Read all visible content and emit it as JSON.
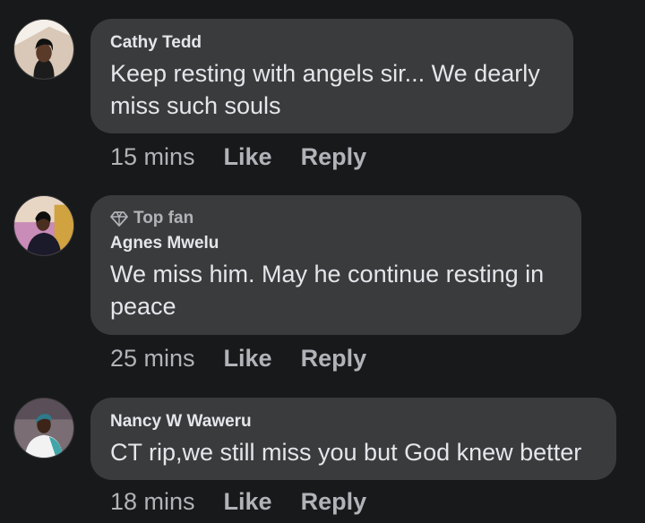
{
  "comments": [
    {
      "author": "Cathy Tedd",
      "text": "Keep resting with angels sir... We dearly miss such souls",
      "time": "15 mins",
      "like_label": "Like",
      "reply_label": "Reply",
      "badge": ""
    },
    {
      "author": "Agnes Mwelu",
      "text": "We miss him. May he continue resting in peace",
      "time": "25 mins",
      "like_label": "Like",
      "reply_label": "Reply",
      "badge": "Top fan",
      "badge_icon": "diamond-icon"
    },
    {
      "author": "Nancy W Waweru",
      "text": "CT rip,we still miss you but God knew better",
      "time": "18 mins",
      "like_label": "Like",
      "reply_label": "Reply",
      "badge": ""
    }
  ],
  "colors": {
    "background": "#18191a",
    "bubble": "#3a3b3c",
    "primary_text": "#e4e6eb",
    "secondary_text": "#b0b3b8"
  }
}
